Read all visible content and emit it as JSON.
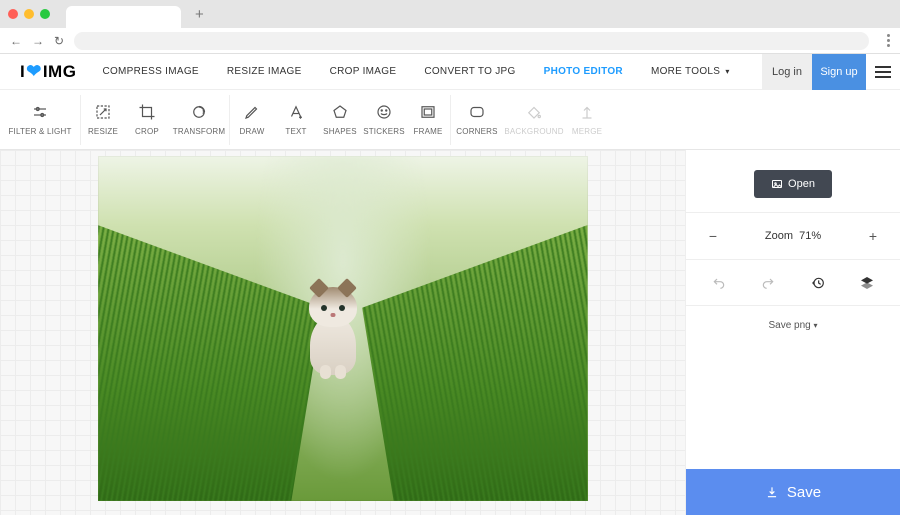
{
  "browser": {
    "newtab": "+"
  },
  "logo": {
    "part1": "I",
    "part2": "IMG"
  },
  "nav": {
    "items": [
      {
        "label": "COMPRESS IMAGE"
      },
      {
        "label": "RESIZE IMAGE"
      },
      {
        "label": "CROP IMAGE"
      },
      {
        "label": "CONVERT TO JPG"
      },
      {
        "label": "PHOTO EDITOR"
      },
      {
        "label": "MORE TOOLS"
      }
    ],
    "login": "Log in",
    "signup": "Sign up"
  },
  "tools": {
    "filter_light": "FILTER & LIGHT",
    "resize": "RESIZE",
    "crop": "CROP",
    "transform": "TRANSFORM",
    "draw": "DRAW",
    "text": "TEXT",
    "shapes": "SHAPES",
    "stickers": "STICKERS",
    "frame": "FRAME",
    "corners": "CORNERS",
    "background": "BACKGROUND",
    "merge": "MERGE"
  },
  "panel": {
    "open": "Open",
    "zoom_label": "Zoom",
    "zoom_value": "71%",
    "save_format": "Save png",
    "save": "Save"
  },
  "canvas": {
    "subject": "kitten on grass path"
  }
}
